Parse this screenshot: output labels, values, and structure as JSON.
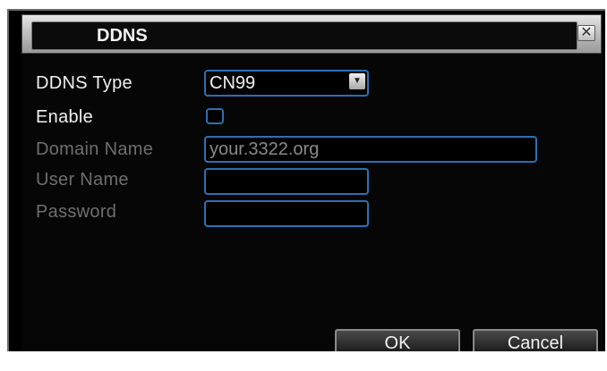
{
  "dialog": {
    "title": "DDNS",
    "close_glyph": "✕"
  },
  "form": {
    "ddns_type_label": "DDNS Type",
    "ddns_type_value": "CN99",
    "ddns_type_arrow": "▼",
    "enable_label": "Enable",
    "enable_checked": false,
    "domain_name_label": "Domain Name",
    "domain_name_value": "your.3322.org",
    "user_name_label": "User Name",
    "user_name_value": "",
    "password_label": "Password",
    "password_value": ""
  },
  "buttons": {
    "ok_label": "OK",
    "cancel_label": "Cancel"
  },
  "colors": {
    "background": "#000000",
    "field_border": "#2f6fb0",
    "active_text": "#f0f0f0",
    "disabled_text": "#6e6e6e"
  }
}
